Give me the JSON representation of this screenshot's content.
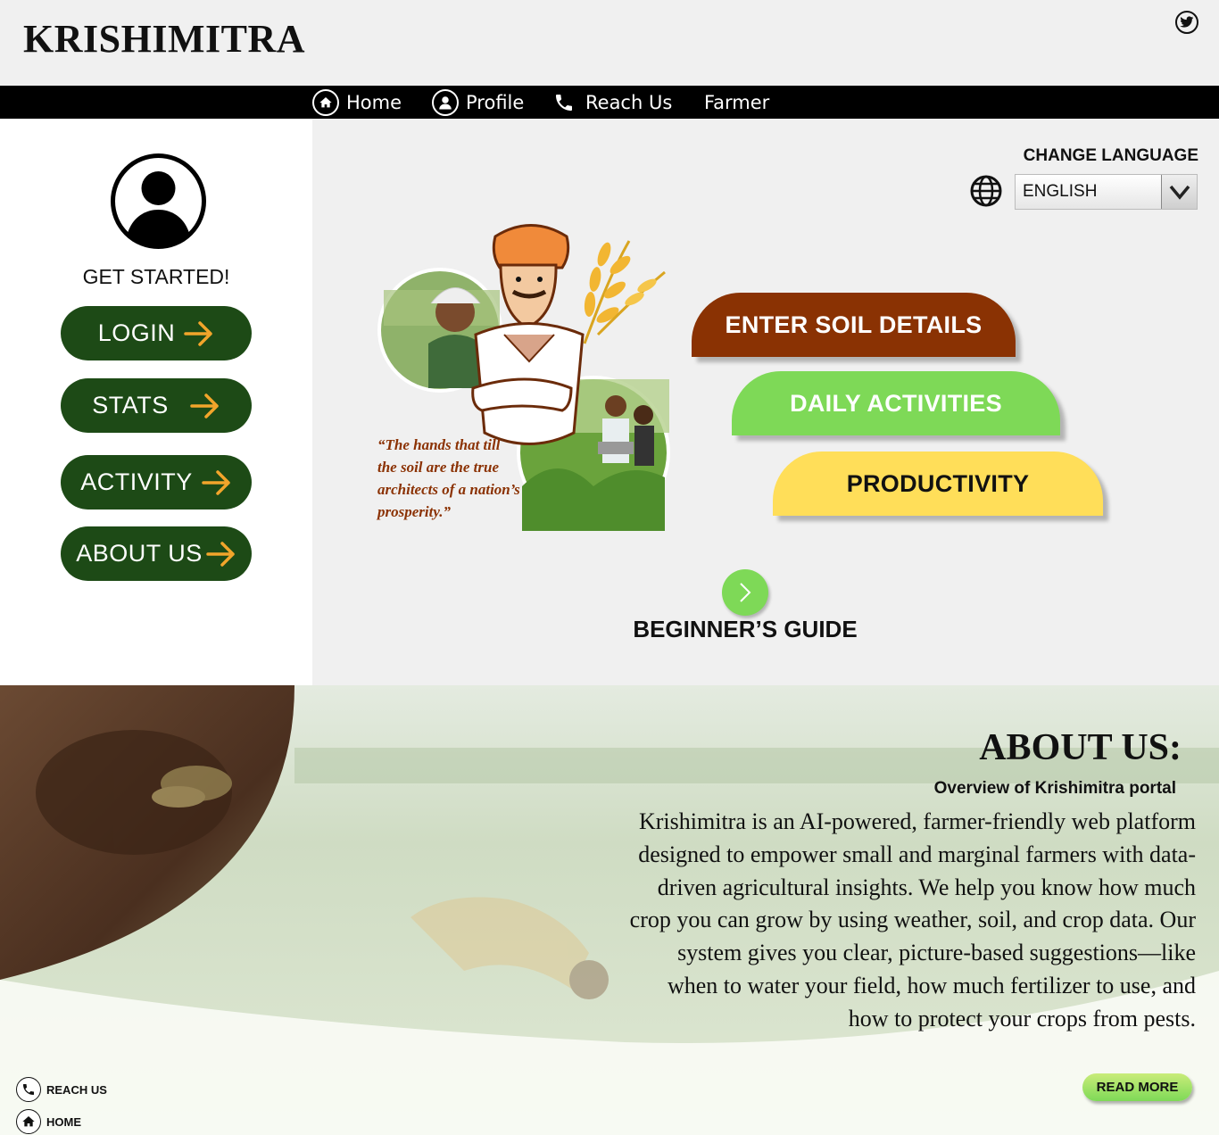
{
  "header": {
    "brand": "KRISHIMITRA",
    "social_icon": "twitter-icon"
  },
  "nav": {
    "items": [
      {
        "label": "Home",
        "icon": "home-icon"
      },
      {
        "label": "Profile",
        "icon": "user-icon"
      },
      {
        "label": "Reach Us",
        "icon": "phone-icon"
      },
      {
        "label": "Farmer"
      }
    ]
  },
  "sidebar": {
    "get_started": "GET STARTED!",
    "buttons": [
      {
        "label": "LOGIN"
      },
      {
        "label": "STATS"
      },
      {
        "label": "ACTIVITY"
      },
      {
        "label": "ABOUT US"
      }
    ]
  },
  "language": {
    "title": "CHANGE LANGUAGE",
    "selected": "ENGLISH"
  },
  "hero": {
    "quote": "“The hands that till the soil are the true architects of a nation’s prosperity.”"
  },
  "actions": {
    "soil": "ENTER SOIL DETAILS",
    "daily": "DAILY ACTIVITIES",
    "productivity": "PRODUCTIVITY"
  },
  "guide": {
    "label": "BEGINNER’S GUIDE"
  },
  "about": {
    "title": "ABOUT US:",
    "subtitle": "Overview of Krishimitra portal",
    "text": "Krishimitra is an AI-powered, farmer-friendly web platform designed to empower small and marginal farmers with data-driven agricultural insights. We help you know how much crop you can grow by using weather, soil, and crop data. Our system gives you clear, picture-based suggestions—like when to water your field, how much fertilizer to use, and how to protect your crops from pests.",
    "read_more": "READ MORE"
  },
  "footer": {
    "reach_us": "REACH US",
    "home": "HOME"
  },
  "colors": {
    "nav_bg": "#000000",
    "button_green": "#1d4a16",
    "arrow_orange": "#f2a52b",
    "soil_brown": "#8a3203",
    "daily_green": "#7ed957",
    "productivity_yellow": "#ffde59"
  }
}
